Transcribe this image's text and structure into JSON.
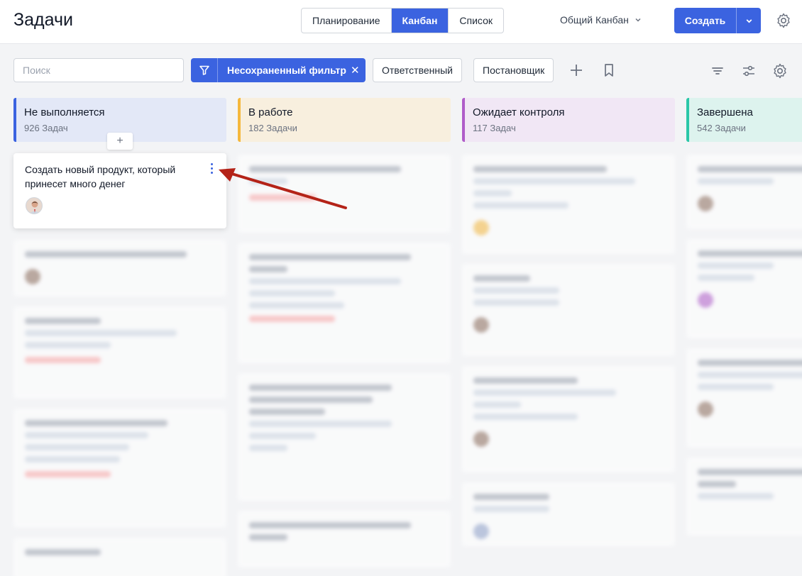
{
  "header": {
    "title": "Задачи",
    "view_tabs": [
      {
        "label": "Планирование",
        "active": false
      },
      {
        "label": "Канбан",
        "active": true
      },
      {
        "label": "Список",
        "active": false
      }
    ],
    "board_select": "Общий Канбан",
    "create_label": "Создать"
  },
  "filters": {
    "search_placeholder": "Поиск",
    "active_filter": "Несохраненный фильтр",
    "assignee_label": "Ответственный",
    "author_label": "Постановщик"
  },
  "columns": [
    {
      "title": "Не выполняется",
      "count": "926 Задач",
      "color": "#3b63e0",
      "bg": "#e3e8f7"
    },
    {
      "title": "В работе",
      "count": "182 Задачи",
      "color": "#f5b83d",
      "bg": "#f8efde"
    },
    {
      "title": "Ожидает контроля",
      "count": "117 Задач",
      "color": "#b05cc9",
      "bg": "#f1e7f5"
    },
    {
      "title": "Завершена",
      "count": "542 Задачи",
      "color": "#2bc7a8",
      "bg": "#ddf3ee"
    }
  ],
  "focus_card": {
    "title": "Создать новый продукт, который принесет много денег"
  },
  "colors": {
    "accent": "#3b63e0",
    "arrow": "#b42318"
  },
  "icons": [
    "chevron-down-icon",
    "gear-icon",
    "funnel-icon",
    "close-icon",
    "plus-icon",
    "bookmark-icon",
    "sort-icon",
    "sliders-icon",
    "kebab-icon",
    "avatar"
  ]
}
